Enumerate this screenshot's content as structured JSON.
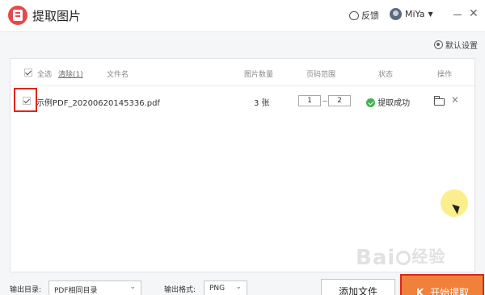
{
  "app": {
    "title": "提取图片",
    "feedback_label": "反馈",
    "user_name": "MiYa",
    "icons": {
      "logo": "app-logo-icon",
      "feedback": "chat-bubble-icon",
      "avatar": "user-avatar"
    }
  },
  "toolbar": {
    "default_settings_label": "默认设置"
  },
  "table": {
    "select_all_label": "全选",
    "clear_label": "清除(1)",
    "headers": {
      "filename": "文件名",
      "image_count": "图片数量",
      "page_range": "页码范围",
      "status": "状态",
      "actions": "操作"
    },
    "rows": [
      {
        "checked": true,
        "filename": "示例PDF_20200620145336.pdf",
        "image_count": "3 张",
        "page_from": "1",
        "page_to": "2",
        "status": "提取成功"
      }
    ]
  },
  "footer": {
    "output_dir_label": "输出目录:",
    "output_dir_value": "PDF相同目录",
    "output_format_label": "输出格式:",
    "output_format_value": "PNG",
    "add_file_label": "添加文件",
    "start_label": "开始提取",
    "start_lead": "K"
  },
  "overlay": {
    "watermark_a": "Bai",
    "watermark_b": "经验"
  },
  "colors": {
    "accent": "#f0813a",
    "logo": "#e8474c",
    "success": "#3cb44b",
    "highlight_box": "#e0241c"
  }
}
